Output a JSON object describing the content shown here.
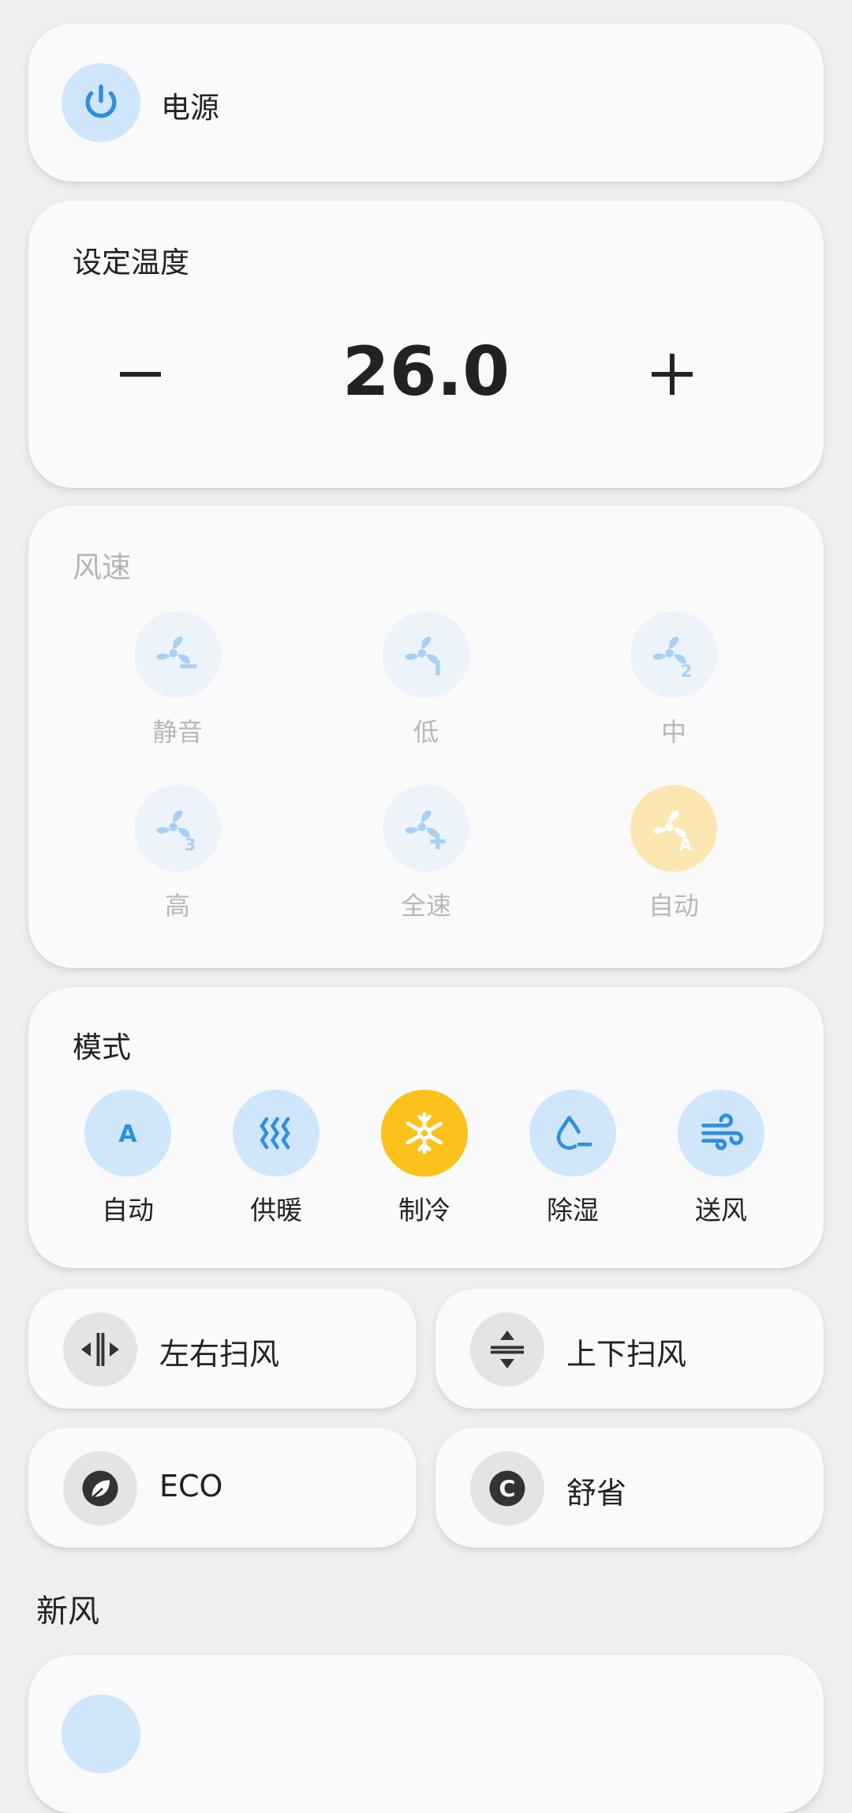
{
  "power": {
    "label": "电源",
    "icon": "power-icon"
  },
  "temperature": {
    "title": "设定温度",
    "value": "26.0",
    "minus": "−",
    "plus": "+"
  },
  "fan_speed": {
    "title": "风速",
    "items": [
      {
        "label": "静音",
        "icon": "fan-silent-icon"
      },
      {
        "label": "低",
        "icon": "fan-low-icon"
      },
      {
        "label": "中",
        "icon": "fan-medium-icon"
      },
      {
        "label": "高",
        "icon": "fan-high-icon"
      },
      {
        "label": "全速",
        "icon": "fan-full-icon"
      },
      {
        "label": "自动",
        "icon": "fan-auto-icon",
        "active": true
      }
    ]
  },
  "mode": {
    "title": "模式",
    "items": [
      {
        "label": "自动",
        "icon": "auto-icon"
      },
      {
        "label": "供暖",
        "icon": "heat-icon"
      },
      {
        "label": "制冷",
        "icon": "snowflake-icon",
        "active": true
      },
      {
        "label": "除湿",
        "icon": "droplet-icon"
      },
      {
        "label": "送风",
        "icon": "wind-icon"
      }
    ]
  },
  "toggles": {
    "swing_h": "左右扫风",
    "swing_v": "上下扫风",
    "eco": "ECO",
    "comfort": "舒省"
  },
  "fresh_air": {
    "title": "新风"
  },
  "colors": {
    "accent_blue": "#2f8ee0",
    "active_yellow": "#fbc21b",
    "light_blue": "#cfe6fb"
  }
}
